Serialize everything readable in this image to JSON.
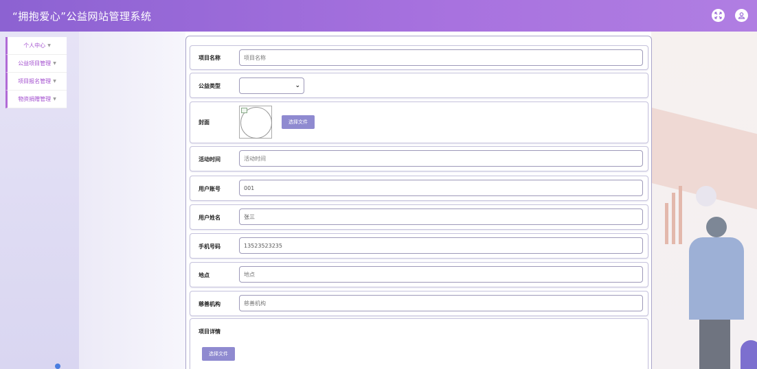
{
  "app": {
    "title": "“拥抱爱心”公益网站管理系统"
  },
  "header_icons": [
    {
      "name": "fullscreen-icon",
      "glyph": "✕"
    },
    {
      "name": "user-icon",
      "glyph": "☺"
    }
  ],
  "sidebar": {
    "items": [
      {
        "label": "个人中心",
        "arrow": "▼"
      },
      {
        "label": "公益项目管理",
        "arrow": "▼"
      },
      {
        "label": "项目报名管理",
        "arrow": "▼"
      },
      {
        "label": "物资捐赠管理",
        "arrow": "▼"
      }
    ]
  },
  "form": {
    "project_name": {
      "label": "项目名称",
      "placeholder": "项目名称",
      "value": ""
    },
    "category": {
      "label": "公益类型",
      "value": ""
    },
    "cover": {
      "label": "封面",
      "button": "选择文件"
    },
    "activity_time": {
      "label": "活动时间",
      "placeholder": "活动时间",
      "value": ""
    },
    "account": {
      "label": "用户账号",
      "value": "001"
    },
    "username": {
      "label": "用户姓名",
      "value": "张三"
    },
    "phone": {
      "label": "手机号码",
      "value": "13523523235"
    },
    "location": {
      "label": "地点",
      "placeholder": "地点",
      "value": ""
    },
    "charity": {
      "label": "慈善机构",
      "placeholder": "慈善机构",
      "value": ""
    },
    "details": {
      "label": "项目详情",
      "button": "选择文件"
    }
  },
  "colors": {
    "header_start": "#8c62d2",
    "header_end": "#b07ee2",
    "sidebar_accent": "#b06ad6",
    "button": "#8f8ad0"
  }
}
